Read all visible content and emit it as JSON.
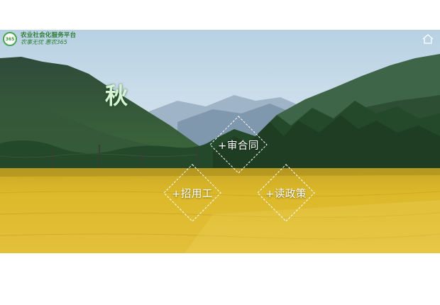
{
  "brand": {
    "badge": "365",
    "title": "农业社会化服务平台",
    "slogan": "农事无忧 惠农365"
  },
  "header": {
    "home_icon": "home-icon"
  },
  "hero": {
    "season": "秋",
    "actions": [
      {
        "label": "+审合同",
        "icon": "diamond-outline-icon"
      },
      {
        "label": "+招用工",
        "icon": "diamond-outline-icon"
      },
      {
        "label": "+读政策",
        "icon": "diamond-outline-icon"
      }
    ]
  },
  "colors": {
    "brand_green": "#2e7d32",
    "field_gold": "#d8b21f",
    "sky": "#c9dce8"
  }
}
